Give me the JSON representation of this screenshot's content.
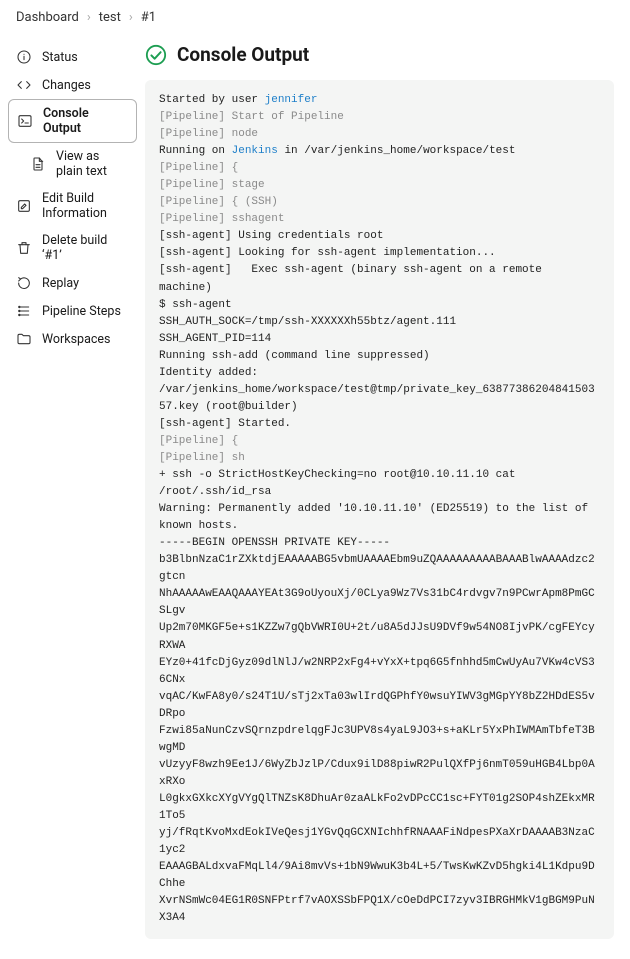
{
  "breadcrumb": [
    "Dashboard",
    "test",
    "#1"
  ],
  "sidebar": {
    "items": [
      {
        "name": "status",
        "label": "Status",
        "icon": "info"
      },
      {
        "name": "changes",
        "label": "Changes",
        "icon": "code"
      },
      {
        "name": "console-output",
        "label": "Console Output",
        "icon": "terminal",
        "selected": true
      },
      {
        "name": "view-plain-text",
        "label": "View as plain text",
        "icon": "document",
        "sub": true
      },
      {
        "name": "edit-build-info",
        "label": "Edit Build Information",
        "icon": "edit"
      },
      {
        "name": "delete-build",
        "label": "Delete build ‘#1’",
        "icon": "trash"
      },
      {
        "name": "replay",
        "label": "Replay",
        "icon": "redo"
      },
      {
        "name": "pipeline-steps",
        "label": "Pipeline Steps",
        "icon": "steps"
      },
      {
        "name": "workspaces",
        "label": "Workspaces",
        "icon": "folder"
      }
    ]
  },
  "page": {
    "title": "Console Output"
  },
  "console": {
    "lines": [
      {
        "segments": [
          {
            "t": "Started by user "
          },
          {
            "t": "jennifer",
            "cls": "link"
          }
        ]
      },
      {
        "segments": [
          {
            "t": "[Pipeline] Start of Pipeline",
            "cls": "dim"
          }
        ]
      },
      {
        "segments": [
          {
            "t": "[Pipeline] node",
            "cls": "dim"
          }
        ]
      },
      {
        "segments": [
          {
            "t": "Running on "
          },
          {
            "t": "Jenkins",
            "cls": "link"
          },
          {
            "t": " in /var/jenkins_home/workspace/test"
          }
        ]
      },
      {
        "segments": [
          {
            "t": "[Pipeline] {",
            "cls": "dim"
          }
        ]
      },
      {
        "segments": [
          {
            "t": "[Pipeline] stage",
            "cls": "dim"
          }
        ]
      },
      {
        "segments": [
          {
            "t": "[Pipeline] { (SSH)",
            "cls": "dim"
          }
        ]
      },
      {
        "segments": [
          {
            "t": "[Pipeline] sshagent",
            "cls": "dim"
          }
        ]
      },
      {
        "segments": [
          {
            "t": "[ssh-agent] Using credentials root"
          }
        ]
      },
      {
        "segments": [
          {
            "t": "[ssh-agent] Looking for ssh-agent implementation..."
          }
        ]
      },
      {
        "segments": [
          {
            "t": "[ssh-agent]   Exec ssh-agent (binary ssh-agent on a remote machine)"
          }
        ]
      },
      {
        "segments": [
          {
            "t": "$ ssh-agent"
          }
        ]
      },
      {
        "segments": [
          {
            "t": "SSH_AUTH_SOCK=/tmp/ssh-XXXXXXh55btz/agent.111"
          }
        ]
      },
      {
        "segments": [
          {
            "t": "SSH_AGENT_PID=114"
          }
        ]
      },
      {
        "segments": [
          {
            "t": "Running ssh-add (command line suppressed)"
          }
        ]
      },
      {
        "segments": [
          {
            "t": "Identity added: /var/jenkins_home/workspace/test@tmp/private_key_6387738620484150357.key (root@builder)"
          }
        ]
      },
      {
        "segments": [
          {
            "t": "[ssh-agent] Started."
          }
        ]
      },
      {
        "segments": [
          {
            "t": "[Pipeline] {",
            "cls": "dim"
          }
        ]
      },
      {
        "segments": [
          {
            "t": "[Pipeline] sh",
            "cls": "dim"
          }
        ]
      },
      {
        "segments": [
          {
            "t": "+ ssh -o StrictHostKeyChecking=no root@10.10.11.10 cat /root/.ssh/id_rsa"
          }
        ]
      },
      {
        "segments": [
          {
            "t": "Warning: Permanently added '10.10.11.10' (ED25519) to the list of known hosts."
          }
        ]
      },
      {
        "segments": [
          {
            "t": "-----BEGIN OPENSSH PRIVATE KEY-----"
          }
        ]
      },
      {
        "segments": [
          {
            "t": "b3BlbnNzaC1rZXktdjEAAAAABG5vbmUAAAAEbm9uZQAAAAAAAAABAAABlwAAAAdzc2gtcn"
          }
        ]
      },
      {
        "segments": [
          {
            "t": "NhAAAAAwEAAQAAAYEAt3G9oUyouXj/0CLya9Wz7Vs31bC4rdvgv7n9PCwrApm8PmGCSLgv"
          }
        ]
      },
      {
        "segments": [
          {
            "t": "Up2m70MKGF5e+s1KZZw7gQbVWRI0U+2t/u8A5dJJsU9DVf9w54NO8IjvPK/cgFEYcyRXWA"
          }
        ]
      },
      {
        "segments": [
          {
            "t": "EYz0+41fcDjGyz09dlNlJ/w2NRP2xFg4+vYxX+tpq6G5fnhhd5mCwUyAu7VKw4cVS36CNx"
          }
        ]
      },
      {
        "segments": [
          {
            "t": "vqAC/KwFA8y0/s24T1U/sTj2xTa03wlIrdQGPhfY0wsuYIWV3gMGpYY8bZ2HDdES5vDRpo"
          }
        ]
      },
      {
        "segments": [
          {
            "t": "Fzwi85aNunCzvSQrnzpdrelqgFJc3UPV8s4yaL9JO3+s+aKLr5YxPhIWMAmTbfeT3BwgMD"
          }
        ]
      },
      {
        "segments": [
          {
            "t": "vUzyyF8wzh9Ee1J/6WyZbJzlP/Cdux9ilD88piwR2PulQXfPj6nmT059uHGB4Lbp0AxRXo"
          }
        ]
      },
      {
        "segments": [
          {
            "t": "L0gkxGXkcXYgVYgQlTNZsK8DhuAr0zaALkFo2vDPcCC1sc+FYT01g2SOP4shZEkxMR1To5"
          }
        ]
      },
      {
        "segments": [
          {
            "t": "yj/fRqtKvoMxdEokIVeQesj1YGvQqGCXNIchhfRNAAAFiNdpesPXaXrDAAAAB3NzaC1yc2"
          }
        ]
      },
      {
        "segments": [
          {
            "t": "EAAAGBALdxvaFMqLl4/9Ai8mvVs+1bN9WwuK3b4L+5/TwsKwKZvD5hgki4L1Kdpu9DChhe"
          }
        ]
      },
      {
        "segments": [
          {
            "t": "XvrNSmWc04EG1R0SNFPtrf7vAOXSSbFPQ1X/cOeDdPCI7zyv3IBRGHMkV1gBGM9PuNX3A4"
          }
        ]
      }
    ]
  }
}
